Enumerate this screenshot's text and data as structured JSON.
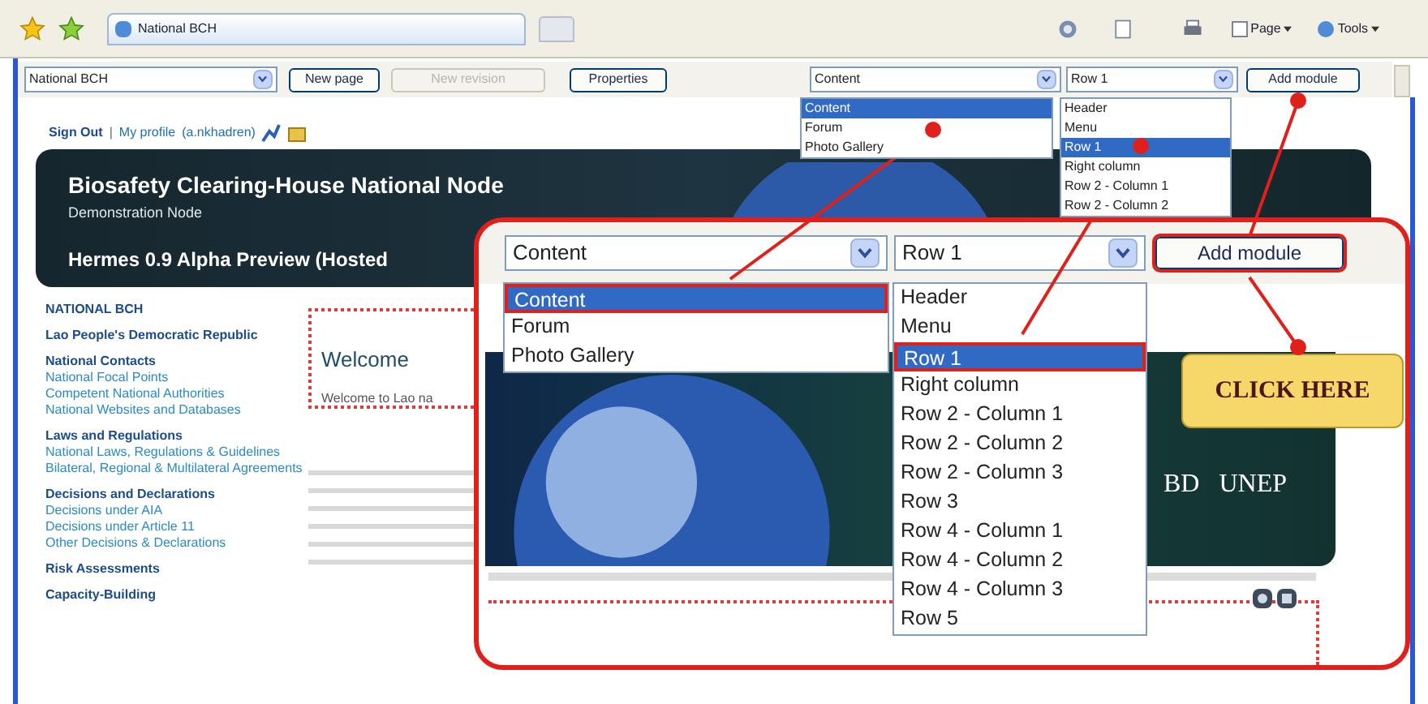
{
  "browser": {
    "tab_title": "National BCH",
    "commands": [
      "Page",
      "Tools"
    ]
  },
  "toolbar": {
    "page_select": {
      "value": "National BCH"
    },
    "buttons": [
      {
        "label": "New page",
        "disabled": false
      },
      {
        "label": "New revision",
        "disabled": true
      },
      {
        "label": "Properties",
        "disabled": false
      }
    ],
    "module_select": {
      "value": "Content",
      "options": [
        {
          "label": "Content",
          "selected": true
        },
        {
          "label": "Forum",
          "selected": false
        },
        {
          "label": "Photo Gallery",
          "selected": false
        }
      ]
    },
    "position_select": {
      "value": "Row 1",
      "options": [
        {
          "label": "Header",
          "selected": false
        },
        {
          "label": "Menu",
          "selected": false
        },
        {
          "label": "Row 1",
          "selected": true
        },
        {
          "label": "Right column",
          "selected": false
        },
        {
          "label": "Row 2 - Column 1",
          "selected": false
        },
        {
          "label": "Row 2 - Column 2",
          "selected": false
        }
      ]
    },
    "add_button": "Add module"
  },
  "page": {
    "sign_out": "Sign Out",
    "separator": "|",
    "profile": "My profile",
    "user": "(a.nkhadren)",
    "banner": {
      "title": "Biosafety Clearing-House National Node",
      "subtitle": "Demonstration Node",
      "version": "Hermes 0.9 Alpha Preview (Hosted"
    },
    "nav": [
      {
        "heading": "NATIONAL BCH"
      },
      {
        "heading": "Lao People's Democratic Republic"
      },
      {
        "heading": "National Contacts",
        "links": [
          "National Focal Points",
          "Competent National Authorities",
          "National Websites and Databases"
        ]
      },
      {
        "heading": "Laws and Regulations",
        "links": [
          "National Laws, Regulations & Guidelines",
          "Bilateral, Regional & Multilateral Agreements"
        ]
      },
      {
        "heading": "Decisions and Declarations",
        "links": [
          "Decisions under AIA",
          "Decisions under Article 11",
          "Other Decisions & Declarations"
        ]
      },
      {
        "heading": "Risk Assessments"
      },
      {
        "heading": "Capacity-Building"
      }
    ],
    "welcome": {
      "title": "Welcome",
      "text": "Welcome to Lao na"
    }
  },
  "callout": {
    "module_select": {
      "value": "Content",
      "options": [
        {
          "label": "Content",
          "selected": true
        },
        {
          "label": "Forum",
          "selected": false
        },
        {
          "label": "Photo Gallery",
          "selected": false
        }
      ]
    },
    "position_select": {
      "value": "Row 1",
      "options": [
        {
          "label": "Header",
          "selected": false
        },
        {
          "label": "Menu",
          "selected": false
        },
        {
          "label": "Row 1",
          "selected": true
        },
        {
          "label": "Right column",
          "selected": false
        },
        {
          "label": "Row 2 - Column 1",
          "selected": false
        },
        {
          "label": "Row 2 - Column 2",
          "selected": false
        },
        {
          "label": "Row 2 - Column 3",
          "selected": false
        },
        {
          "label": "Row 3",
          "selected": false
        },
        {
          "label": "Row 4 - Column 1",
          "selected": false
        },
        {
          "label": "Row 4 - Column 2",
          "selected": false
        },
        {
          "label": "Row 4 - Column 3",
          "selected": false
        },
        {
          "label": "Row 5",
          "selected": false
        }
      ]
    },
    "add_button": "Add module",
    "logos": [
      "BD",
      "UNEP"
    ],
    "click_here": "CLICK HERE"
  }
}
